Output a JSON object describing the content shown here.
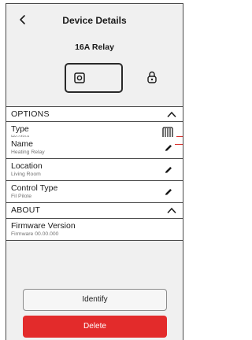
{
  "header": {
    "title": "Device Details",
    "device_name": "16A Relay"
  },
  "icons": {
    "back": "chevron-left-icon",
    "device": "relay-device-icon",
    "lock": "lock-icon",
    "collapse": "chevron-up-icon",
    "edit": "pencil-icon",
    "heating": "radiator-icon"
  },
  "sections": {
    "options_label": "OPTIONS",
    "about_label": "ABOUT"
  },
  "options": {
    "type": {
      "label": "Type",
      "value": "Heating"
    },
    "name": {
      "label": "Name",
      "value": "Heating Relay"
    },
    "location": {
      "label": "Location",
      "value": "Living Room"
    },
    "control_type": {
      "label": "Control Type",
      "value": "Fil Pilote"
    }
  },
  "about": {
    "firmware": {
      "label": "Firmware Version",
      "value": "Firmware 00.00.000"
    }
  },
  "actions": {
    "identify_label": "Identify",
    "delete_label": "Delete"
  },
  "colors": {
    "delete_background": "#e32b2b",
    "callout_line": "#d9322e",
    "panel_background": "#f0f0f0"
  }
}
